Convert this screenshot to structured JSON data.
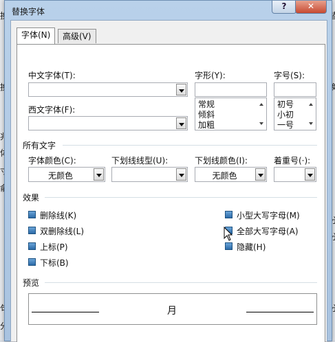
{
  "background": {
    "fragments": [
      "换",
      "换",
      "兆",
      "体",
      "寸",
      "兪",
      "句",
      "分",
      "替",
      "换",
      "分",
      "分",
      "分"
    ]
  },
  "dialog": {
    "title": "替换字体",
    "help_button": "?",
    "close_button": "✕",
    "tabs": [
      {
        "label": "字体(N)",
        "active": true
      },
      {
        "label": "高级(V)",
        "active": false
      }
    ],
    "font": {
      "chinese_font_label": "中文字体(T):",
      "chinese_font_value": "",
      "western_font_label": "西文字体(F):",
      "western_font_value": "",
      "style_label": "字形(Y):",
      "style_value": "",
      "style_options": [
        "常规",
        "倾斜",
        "加粗"
      ],
      "size_label": "字号(S):",
      "size_value": "",
      "size_options": [
        "初号",
        "小初",
        "一号"
      ]
    },
    "all_text": {
      "section_label": "所有文字",
      "font_color_label": "字体颜色(C):",
      "font_color_value": "无颜色",
      "underline_style_label": "下划线线型(U):",
      "underline_style_value": "",
      "underline_color_label": "下划线颜色(I):",
      "underline_color_value": "无颜色",
      "emphasis_label": "着重号(·):",
      "emphasis_value": ""
    },
    "effects": {
      "section_label": "效果",
      "items": [
        {
          "label": "删除线(K)"
        },
        {
          "label": "双删除线(L)"
        },
        {
          "label": "上标(P)"
        },
        {
          "label": "下标(B)"
        },
        {
          "label": "小型大写字母(M)"
        },
        {
          "label": "全部大写字母(A)"
        },
        {
          "label": "隐藏(H)"
        }
      ]
    },
    "preview": {
      "section_label": "预览",
      "sample_text": "月"
    }
  }
}
